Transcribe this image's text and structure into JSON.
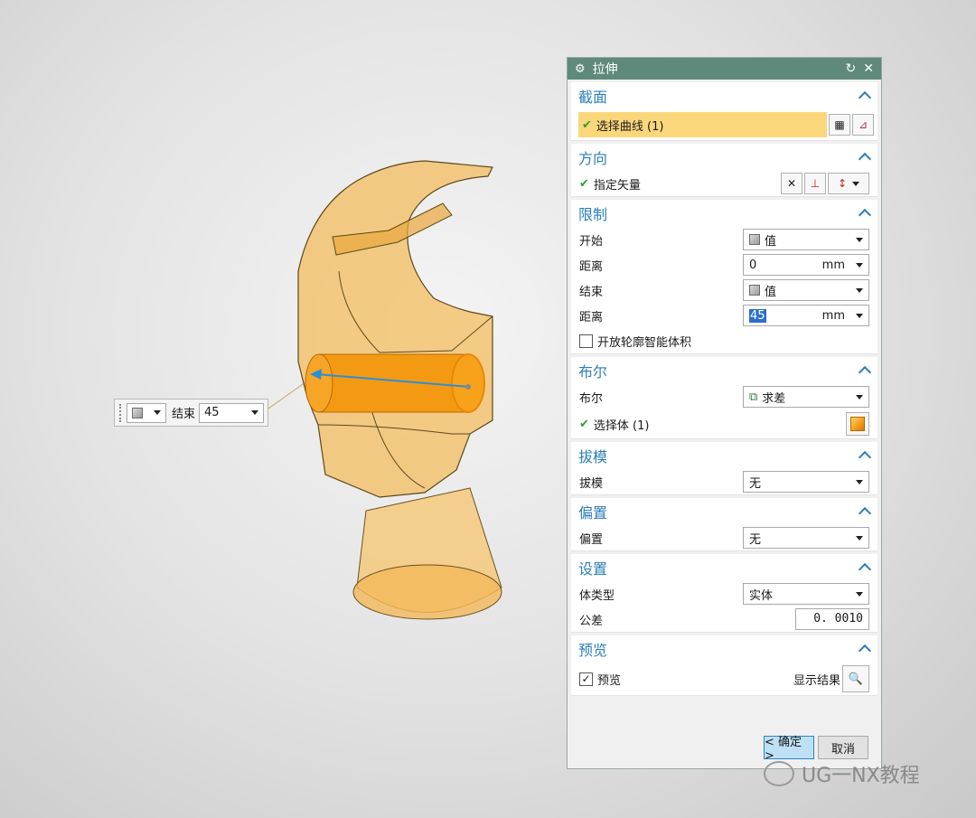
{
  "dialog": {
    "title": "拉伸",
    "sections": {
      "section": {
        "header": "截面",
        "select_curve": "选择曲线 (1)"
      },
      "direction": {
        "header": "方向",
        "specify_vector": "指定矢量"
      },
      "limits": {
        "header": "限制",
        "start_label": "开始",
        "start_value": "值",
        "start_dist_label": "距离",
        "start_dist": "0",
        "start_unit": "mm",
        "end_label": "结束",
        "end_value": "值",
        "end_dist_label": "距离",
        "end_dist": "45",
        "end_unit": "mm",
        "open_profile": "开放轮廓智能体积"
      },
      "boolean": {
        "header": "布尔",
        "boolean_label": "布尔",
        "boolean_value": "求差",
        "select_body": "选择体 (1)"
      },
      "draft": {
        "header": "拔模",
        "draft_label": "拔模",
        "draft_value": "无"
      },
      "offset": {
        "header": "偏置",
        "offset_label": "偏置",
        "offset_value": "无"
      },
      "settings": {
        "header": "设置",
        "body_type_label": "体类型",
        "body_type_value": "实体",
        "tolerance_label": "公差",
        "tolerance_value": "0. 0010"
      },
      "preview": {
        "header": "预览",
        "preview_label": "预览",
        "show_result": "显示结果"
      }
    },
    "ok": "< 确定 >",
    "cancel": "取消"
  },
  "handle": {
    "label": "结束",
    "value": "45"
  },
  "watermark": "UG一NX教程",
  "colors": {
    "titlebar": "#5f8a7b",
    "section_header": "#2c7fb8",
    "selection_highlight": "#fbd77c",
    "model_fill": "#f5b84a",
    "cylinder": "#f39a12"
  }
}
